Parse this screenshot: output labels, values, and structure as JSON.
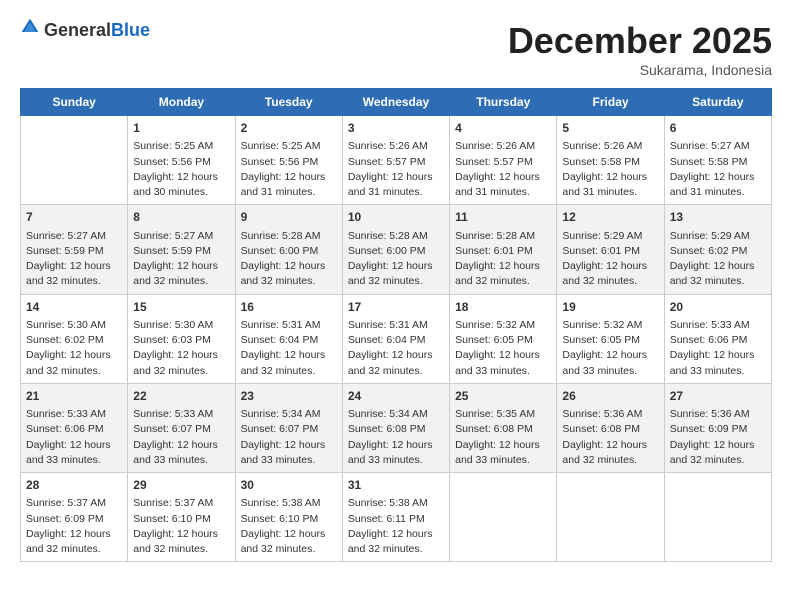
{
  "logo": {
    "text_general": "General",
    "text_blue": "Blue"
  },
  "title": "December 2025",
  "subtitle": "Sukarama, Indonesia",
  "days_of_week": [
    "Sunday",
    "Monday",
    "Tuesday",
    "Wednesday",
    "Thursday",
    "Friday",
    "Saturday"
  ],
  "weeks": [
    [
      {
        "day": "",
        "content": ""
      },
      {
        "day": "1",
        "content": "Sunrise: 5:25 AM\nSunset: 5:56 PM\nDaylight: 12 hours\nand 30 minutes."
      },
      {
        "day": "2",
        "content": "Sunrise: 5:25 AM\nSunset: 5:56 PM\nDaylight: 12 hours\nand 31 minutes."
      },
      {
        "day": "3",
        "content": "Sunrise: 5:26 AM\nSunset: 5:57 PM\nDaylight: 12 hours\nand 31 minutes."
      },
      {
        "day": "4",
        "content": "Sunrise: 5:26 AM\nSunset: 5:57 PM\nDaylight: 12 hours\nand 31 minutes."
      },
      {
        "day": "5",
        "content": "Sunrise: 5:26 AM\nSunset: 5:58 PM\nDaylight: 12 hours\nand 31 minutes."
      },
      {
        "day": "6",
        "content": "Sunrise: 5:27 AM\nSunset: 5:58 PM\nDaylight: 12 hours\nand 31 minutes."
      }
    ],
    [
      {
        "day": "7",
        "content": "Sunrise: 5:27 AM\nSunset: 5:59 PM\nDaylight: 12 hours\nand 32 minutes."
      },
      {
        "day": "8",
        "content": "Sunrise: 5:27 AM\nSunset: 5:59 PM\nDaylight: 12 hours\nand 32 minutes."
      },
      {
        "day": "9",
        "content": "Sunrise: 5:28 AM\nSunset: 6:00 PM\nDaylight: 12 hours\nand 32 minutes."
      },
      {
        "day": "10",
        "content": "Sunrise: 5:28 AM\nSunset: 6:00 PM\nDaylight: 12 hours\nand 32 minutes."
      },
      {
        "day": "11",
        "content": "Sunrise: 5:28 AM\nSunset: 6:01 PM\nDaylight: 12 hours\nand 32 minutes."
      },
      {
        "day": "12",
        "content": "Sunrise: 5:29 AM\nSunset: 6:01 PM\nDaylight: 12 hours\nand 32 minutes."
      },
      {
        "day": "13",
        "content": "Sunrise: 5:29 AM\nSunset: 6:02 PM\nDaylight: 12 hours\nand 32 minutes."
      }
    ],
    [
      {
        "day": "14",
        "content": "Sunrise: 5:30 AM\nSunset: 6:02 PM\nDaylight: 12 hours\nand 32 minutes."
      },
      {
        "day": "15",
        "content": "Sunrise: 5:30 AM\nSunset: 6:03 PM\nDaylight: 12 hours\nand 32 minutes."
      },
      {
        "day": "16",
        "content": "Sunrise: 5:31 AM\nSunset: 6:04 PM\nDaylight: 12 hours\nand 32 minutes."
      },
      {
        "day": "17",
        "content": "Sunrise: 5:31 AM\nSunset: 6:04 PM\nDaylight: 12 hours\nand 32 minutes."
      },
      {
        "day": "18",
        "content": "Sunrise: 5:32 AM\nSunset: 6:05 PM\nDaylight: 12 hours\nand 33 minutes."
      },
      {
        "day": "19",
        "content": "Sunrise: 5:32 AM\nSunset: 6:05 PM\nDaylight: 12 hours\nand 33 minutes."
      },
      {
        "day": "20",
        "content": "Sunrise: 5:33 AM\nSunset: 6:06 PM\nDaylight: 12 hours\nand 33 minutes."
      }
    ],
    [
      {
        "day": "21",
        "content": "Sunrise: 5:33 AM\nSunset: 6:06 PM\nDaylight: 12 hours\nand 33 minutes."
      },
      {
        "day": "22",
        "content": "Sunrise: 5:33 AM\nSunset: 6:07 PM\nDaylight: 12 hours\nand 33 minutes."
      },
      {
        "day": "23",
        "content": "Sunrise: 5:34 AM\nSunset: 6:07 PM\nDaylight: 12 hours\nand 33 minutes."
      },
      {
        "day": "24",
        "content": "Sunrise: 5:34 AM\nSunset: 6:08 PM\nDaylight: 12 hours\nand 33 minutes."
      },
      {
        "day": "25",
        "content": "Sunrise: 5:35 AM\nSunset: 6:08 PM\nDaylight: 12 hours\nand 33 minutes."
      },
      {
        "day": "26",
        "content": "Sunrise: 5:36 AM\nSunset: 6:08 PM\nDaylight: 12 hours\nand 32 minutes."
      },
      {
        "day": "27",
        "content": "Sunrise: 5:36 AM\nSunset: 6:09 PM\nDaylight: 12 hours\nand 32 minutes."
      }
    ],
    [
      {
        "day": "28",
        "content": "Sunrise: 5:37 AM\nSunset: 6:09 PM\nDaylight: 12 hours\nand 32 minutes."
      },
      {
        "day": "29",
        "content": "Sunrise: 5:37 AM\nSunset: 6:10 PM\nDaylight: 12 hours\nand 32 minutes."
      },
      {
        "day": "30",
        "content": "Sunrise: 5:38 AM\nSunset: 6:10 PM\nDaylight: 12 hours\nand 32 minutes."
      },
      {
        "day": "31",
        "content": "Sunrise: 5:38 AM\nSunset: 6:11 PM\nDaylight: 12 hours\nand 32 minutes."
      },
      {
        "day": "",
        "content": ""
      },
      {
        "day": "",
        "content": ""
      },
      {
        "day": "",
        "content": ""
      }
    ]
  ]
}
